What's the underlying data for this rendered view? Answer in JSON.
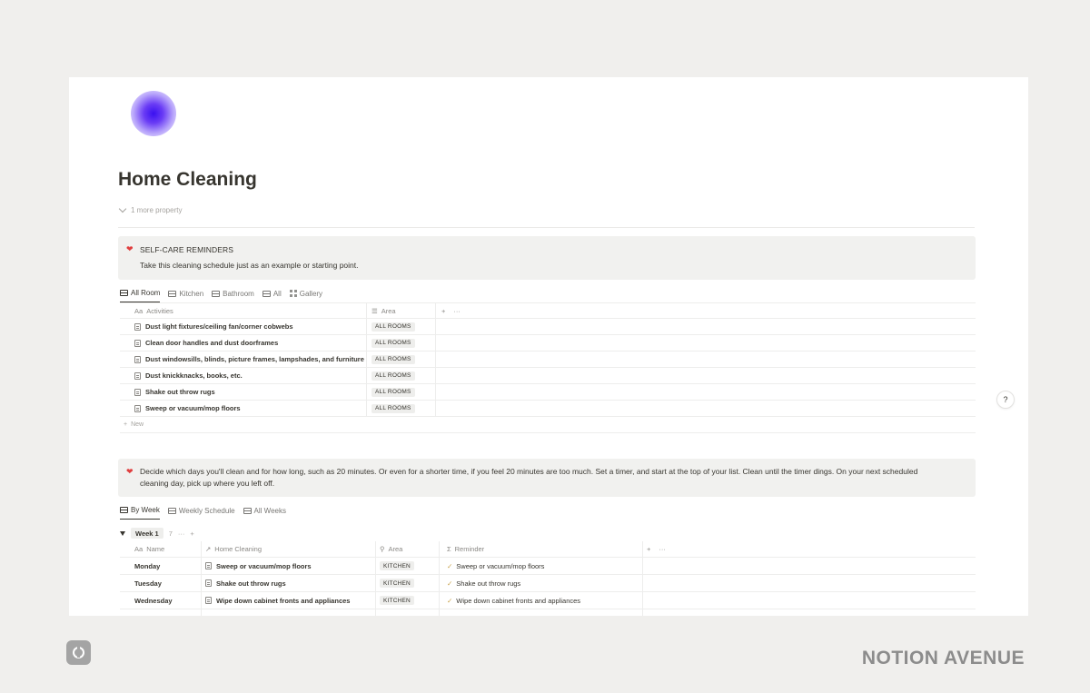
{
  "page": {
    "title": "Home Cleaning",
    "more_property": "1 more property"
  },
  "callout1": {
    "icon": "heart-icon",
    "title": "SELF-CARE REMINDERS",
    "text": "Take this cleaning schedule just as an example or starting point."
  },
  "view1": {
    "tabs": [
      {
        "label": "All Room",
        "icon": "table-icon"
      },
      {
        "label": "Kitchen",
        "icon": "table-icon"
      },
      {
        "label": "Bathroom",
        "icon": "table-icon"
      },
      {
        "label": "All",
        "icon": "table-icon"
      },
      {
        "label": "Gallery",
        "icon": "gallery-icon"
      }
    ],
    "columns": {
      "activities": "Activities",
      "area": "Area",
      "activities_icon": "Aa",
      "area_icon": "list-icon"
    },
    "rows": [
      {
        "activity": "Dust light fixtures/ceiling fan/corner cobwebs",
        "area": "ALL ROOMS"
      },
      {
        "activity": "Clean door handles and dust doorframes",
        "area": "ALL ROOMS"
      },
      {
        "activity": "Dust windowsills, blinds, picture frames, lampshades, and furniture",
        "area": "ALL ROOMS"
      },
      {
        "activity": "Dust knickknacks, books, etc.",
        "area": "ALL ROOMS"
      },
      {
        "activity": "Shake out throw rugs",
        "area": "ALL ROOMS"
      },
      {
        "activity": "Sweep or vacuum/mop floors",
        "area": "ALL ROOMS"
      }
    ],
    "new_label": "New"
  },
  "callout2": {
    "icon": "heart-icon",
    "line1": "Decide which days you'll clean and for how long, such as 20 minutes. Or even for a shorter time, if you feel 20 minutes are too much. Set a timer, and start at the top of your list. Clean until the timer dings. On your next scheduled",
    "line2": "cleaning day, pick up where you left off."
  },
  "view2": {
    "tabs": [
      {
        "label": "By Week",
        "icon": "table-icon"
      },
      {
        "label": "Weekly Schedule",
        "icon": "table-icon"
      },
      {
        "label": "All Weeks",
        "icon": "table-icon"
      }
    ],
    "group": {
      "label": "Week 1",
      "count": "7"
    },
    "columns": {
      "name": "Name",
      "home_cleaning": "Home Cleaning",
      "area": "Area",
      "reminder": "Reminder"
    },
    "rows": [
      {
        "name": "Monday",
        "task": "Sweep or vacuum/mop floors",
        "area": "KITCHEN",
        "reminder": "Sweep or vacuum/mop floors"
      },
      {
        "name": "Tuesday",
        "task": "Shake out throw rugs",
        "area": "KITCHEN",
        "reminder": "Shake out throw rugs"
      },
      {
        "name": "Wednesday",
        "task": "Wipe down cabinet fronts and appliances",
        "area": "KITCHEN",
        "reminder": "Wipe down cabinet fronts and appliances"
      }
    ]
  },
  "help": {
    "label": "?"
  },
  "footer": {
    "brand": "NOTION AVENUE"
  },
  "colors": {
    "background": "#f0efed",
    "page": "#ffffff",
    "callout": "#f1f1ef",
    "heart": "#e03e3e",
    "accent_icon": "#3a10f0"
  }
}
